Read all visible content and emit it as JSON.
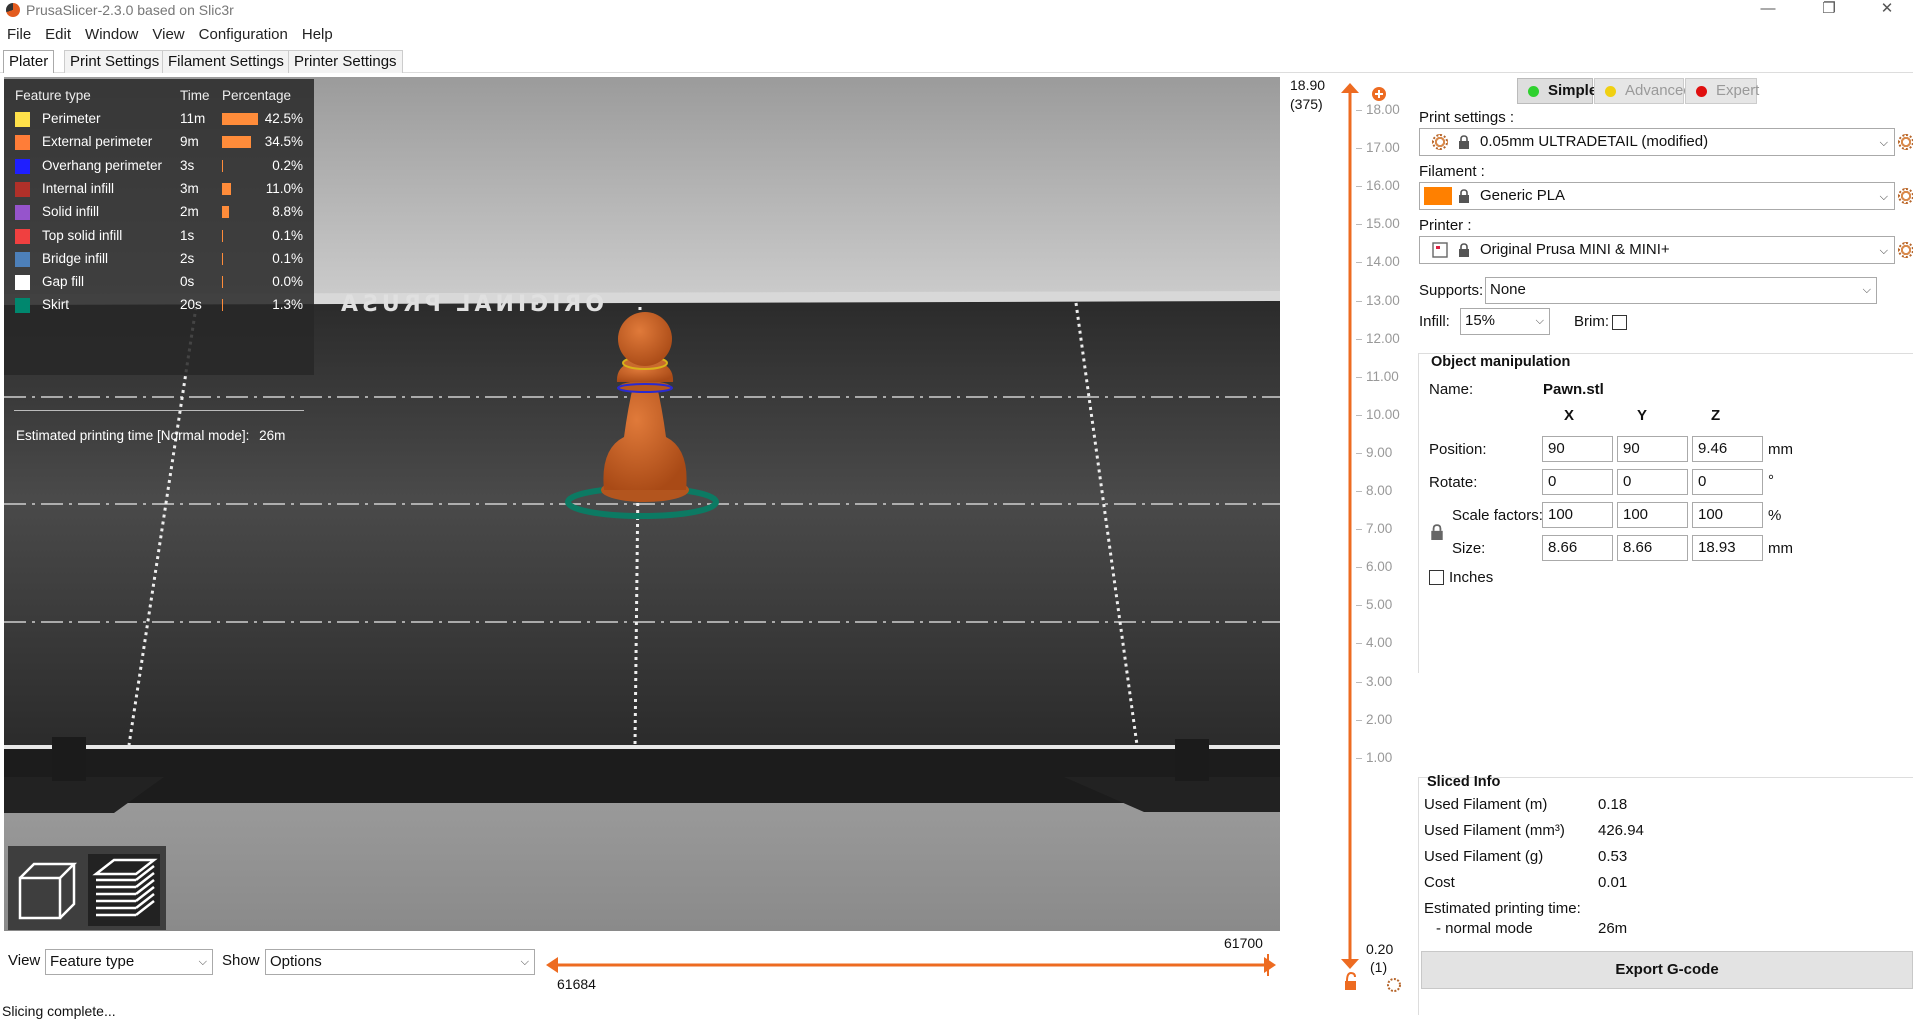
{
  "window": {
    "title": "PrusaSlicer-2.3.0 based on Slic3r",
    "minimize": "—",
    "restore": "❐",
    "close": "✕"
  },
  "menu": [
    "File",
    "Edit",
    "Window",
    "View",
    "Configuration",
    "Help"
  ],
  "tabs": [
    "Plater",
    "Print Settings",
    "Filament Settings",
    "Printer Settings"
  ],
  "legend": {
    "header_feature": "Feature type",
    "header_time": "Time",
    "header_pct": "Percentage",
    "rows": [
      {
        "name": "Perimeter",
        "time": "11m",
        "pct": "42.5%",
        "fraction": 0.425,
        "color": "#ffe14a"
      },
      {
        "name": "External perimeter",
        "time": "9m",
        "pct": "34.5%",
        "fraction": 0.345,
        "color": "#ff7d38"
      },
      {
        "name": "Overhang perimeter",
        "time": "3s",
        "pct": "0.2%",
        "fraction": 0.002,
        "color": "#1f1fff"
      },
      {
        "name": "Internal infill",
        "time": "3m",
        "pct": "11.0%",
        "fraction": 0.11,
        "color": "#b03029"
      },
      {
        "name": "Solid infill",
        "time": "2m",
        "pct": "8.8%",
        "fraction": 0.088,
        "color": "#9654cc"
      },
      {
        "name": "Top solid infill",
        "time": "1s",
        "pct": "0.1%",
        "fraction": 0.001,
        "color": "#f04040"
      },
      {
        "name": "Bridge infill",
        "time": "2s",
        "pct": "0.1%",
        "fraction": 0.001,
        "color": "#4d80ba"
      },
      {
        "name": "Gap fill",
        "time": "0s",
        "pct": "0.0%",
        "fraction": 0.0,
        "color": "#ffffff"
      },
      {
        "name": "Skirt",
        "time": "20s",
        "pct": "1.3%",
        "fraction": 0.013,
        "color": "#00876e"
      }
    ],
    "estimated": "Estimated printing time [Normal mode]:",
    "estimated_value": "26m"
  },
  "bed_text": "ORIGINAL PRUSA",
  "bottom": {
    "view_label": "View",
    "view_value": "Feature type",
    "show_label": "Show",
    "show_value": "Options",
    "h_top": "61700",
    "h_bottom": "61684"
  },
  "status": "Slicing complete...",
  "vslider": {
    "top_value": "18.90",
    "top_layer": "(375)",
    "bottom_value": "0.20",
    "bottom_layer": "(1)",
    "ticks": [
      "18.00",
      "17.00",
      "16.00",
      "15.00",
      "14.00",
      "13.00",
      "12.00",
      "11.00",
      "10.00",
      "9.00",
      "8.00",
      "7.00",
      "6.00",
      "5.00",
      "4.00",
      "3.00",
      "2.00",
      "1.00"
    ]
  },
  "modes": {
    "simple": "Simple",
    "advanced": "Advanced",
    "expert": "Expert",
    "colors": {
      "simple": "#2fd12f",
      "advanced": "#f0d012",
      "expert": "#e01010"
    }
  },
  "print_settings": {
    "label": "Print settings :",
    "value": "0.05mm ULTRADETAIL (modified)"
  },
  "filament": {
    "label": "Filament :",
    "value": "Generic PLA",
    "color": "#ff8000"
  },
  "printer": {
    "label": "Printer :",
    "value": "Original Prusa MINI & MINI+"
  },
  "supports": {
    "label": "Supports:",
    "value": "None"
  },
  "infill": {
    "label": "Infill:",
    "value": "15%"
  },
  "brim": {
    "label": "Brim:"
  },
  "object": {
    "title": "Object manipulation",
    "name_label": "Name:",
    "name": "Pawn.stl",
    "x": "X",
    "y": "Y",
    "z": "Z",
    "position_label": "Position:",
    "position": [
      "90",
      "90",
      "9.46"
    ],
    "position_unit": "mm",
    "rotate_label": "Rotate:",
    "rotate": [
      "0",
      "0",
      "0"
    ],
    "rotate_unit": "°",
    "scale_label": "Scale factors:",
    "scale": [
      "100",
      "100",
      "100"
    ],
    "scale_unit": "%",
    "size_label": "Size:",
    "size": [
      "8.66",
      "8.66",
      "18.93"
    ],
    "size_unit": "mm",
    "inches_label": "Inches"
  },
  "sliced": {
    "title": "Sliced Info",
    "used_m_label": "Used Filament (m)",
    "used_m": "0.18",
    "used_mm3_label": "Used Filament (mm³)",
    "used_mm3": "426.94",
    "used_g_label": "Used Filament (g)",
    "used_g": "0.53",
    "cost_label": "Cost",
    "cost": "0.01",
    "est_label": "Estimated printing time:",
    "normal_label": "- normal mode",
    "normal": "26m"
  },
  "export_label": "Export G-code"
}
